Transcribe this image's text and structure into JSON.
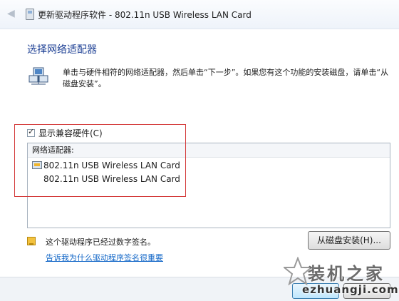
{
  "window": {
    "title": "更新驱动程序软件 - 802.11n USB Wireless LAN Card"
  },
  "page": {
    "heading": "选择网络适配器",
    "instruction": "单击与硬件相符的网络适配器，然后单击“下一步”。如果您有这个功能的安装磁盘，请单击“从磁盘安装”。"
  },
  "compatible": {
    "label": "显示兼容硬件(C)",
    "checked": true
  },
  "adapter_list": {
    "header": "网络适配器:",
    "items": [
      {
        "label": "802.11n USB Wireless LAN Card",
        "icon": "network-adapter-icon"
      },
      {
        "label": "802.11n USB Wireless LAN Card"
      }
    ]
  },
  "signature": {
    "text": "这个驱动程序已经过数字签名。",
    "link": "告诉我为什么驱动程序签名很重要",
    "icon": "certificate-icon"
  },
  "buttons": {
    "have_disk": "从磁盘安装(H)..."
  },
  "watermark": {
    "line1": "装机之家",
    "line2": "ezhuangji.com"
  },
  "colors": {
    "heading": "#1c3f94",
    "link": "#1669c8",
    "highlight_box": "#d43a3a"
  }
}
